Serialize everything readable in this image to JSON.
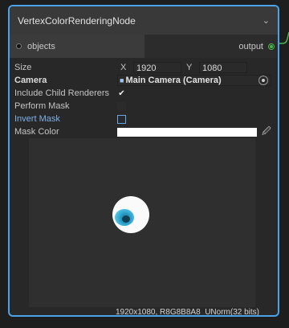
{
  "node": {
    "title": "VertexColorRenderingNode",
    "collapse_icon": "chevron-down-icon",
    "input_port_label": "objects",
    "output_port_label": "output",
    "accent_color": "#4aa3e6",
    "output_color": "#49b849"
  },
  "fields": {
    "size_label": "Size",
    "size_x_label": "X",
    "size_x_value": "1920",
    "size_y_label": "Y",
    "size_y_value": "1080",
    "camera_label": "Camera",
    "camera_value": "Main Camera (Camera)",
    "include_child_label": "Include Child Renderers",
    "include_child_checked": "✔",
    "perform_mask_label": "Perform Mask",
    "invert_mask_label": "Invert Mask",
    "mask_color_label": "Mask Color",
    "mask_color_value": "#ffffff"
  },
  "preview": {
    "caption": "1920x1080, R8G8B8A8_UNorm(32 bits)"
  }
}
